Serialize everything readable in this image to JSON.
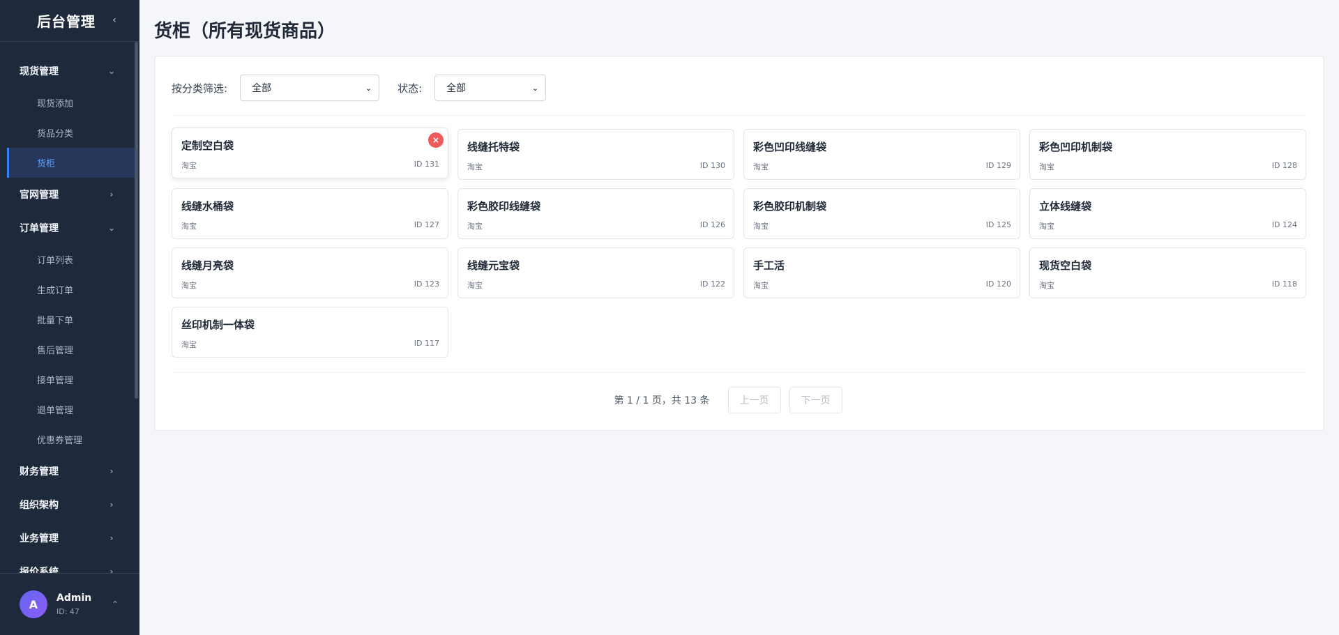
{
  "sidebar": {
    "brand": "后台管理",
    "groups": [
      {
        "label": "现货管理",
        "expanded": true,
        "items": [
          "现货添加",
          "货品分类",
          "货柜"
        ]
      },
      {
        "label": "官网管理",
        "expanded": false,
        "items": []
      },
      {
        "label": "订单管理",
        "expanded": true,
        "items": [
          "订单列表",
          "生成订单",
          "批量下单",
          "售后管理",
          "接单管理",
          "退单管理",
          "优惠券管理"
        ]
      },
      {
        "label": "财务管理",
        "expanded": false,
        "items": []
      },
      {
        "label": "组织架构",
        "expanded": false,
        "items": []
      },
      {
        "label": "业务管理",
        "expanded": false,
        "items": []
      },
      {
        "label": "报价系统",
        "expanded": false,
        "items": []
      }
    ],
    "active_item": "货柜",
    "user": {
      "avatar_letter": "A",
      "name": "Admin",
      "id_text": "ID: 47"
    }
  },
  "page": {
    "title": "货柜（所有现货商品）"
  },
  "filters": {
    "category_label": "按分类筛选:",
    "category_value": "全部",
    "status_label": "状态:",
    "status_value": "全部"
  },
  "products": [
    {
      "name": "定制空白袋",
      "source": "淘宝",
      "id_text": "ID 131"
    },
    {
      "name": "线缝托特袋",
      "source": "淘宝",
      "id_text": "ID 130"
    },
    {
      "name": "彩色凹印线缝袋",
      "source": "淘宝",
      "id_text": "ID 129"
    },
    {
      "name": "彩色凹印机制袋",
      "source": "淘宝",
      "id_text": "ID 128"
    },
    {
      "name": "线缝水桶袋",
      "source": "淘宝",
      "id_text": "ID 127"
    },
    {
      "name": "彩色胶印线缝袋",
      "source": "淘宝",
      "id_text": "ID 126"
    },
    {
      "name": "彩色胶印机制袋",
      "source": "淘宝",
      "id_text": "ID 125"
    },
    {
      "name": "立体线缝袋",
      "source": "淘宝",
      "id_text": "ID 124"
    },
    {
      "name": "线缝月亮袋",
      "source": "淘宝",
      "id_text": "ID 123"
    },
    {
      "name": "线缝元宝袋",
      "source": "淘宝",
      "id_text": "ID 122"
    },
    {
      "name": "手工活",
      "source": "淘宝",
      "id_text": "ID 120"
    },
    {
      "name": "现货空白袋",
      "source": "淘宝",
      "id_text": "ID 118"
    },
    {
      "name": "丝印机制一体袋",
      "source": "淘宝",
      "id_text": "ID 117"
    }
  ],
  "pagination": {
    "summary": "第 1 / 1 页，共 13 条",
    "prev_label": "上一页",
    "next_label": "下一页"
  },
  "icons": {
    "collapse": "chevron-left-icon",
    "expanded": "chevron-down-icon",
    "collapsed": "chevron-right-icon",
    "user_menu": "chevron-up-icon",
    "remove": "close-icon"
  },
  "colors": {
    "sidebar_bg": "#1e293b",
    "accent": "#3b82f6",
    "remove_button": "#ef5a5a"
  }
}
